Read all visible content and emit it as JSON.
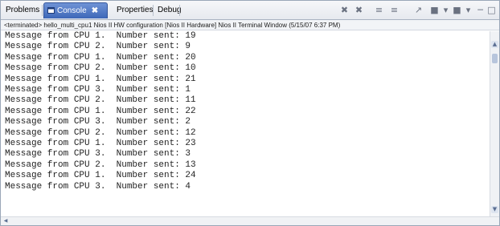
{
  "tabs": [
    {
      "label": "Problems",
      "active": false
    },
    {
      "label": "Console",
      "active": true,
      "close": "✖"
    },
    {
      "label": "Properties",
      "active": false
    },
    {
      "label": "Debug",
      "active": false
    }
  ],
  "toolbar": {
    "icons": [
      "terminate-icon",
      "remove-launches-icon",
      "clear-console-icon",
      "scroll-lock-icon",
      "pin-console-icon",
      "display-console-icon",
      "open-console-icon",
      "minimize-icon",
      "maximize-icon"
    ],
    "glyphs": [
      "✖",
      "✖",
      "≡",
      "≡",
      "↗",
      "■",
      "▾",
      "─",
      "□"
    ]
  },
  "info_line": "<terminated> hello_multi_cpu1 Nios II HW configuration [Nios II Hardware] Nios II Terminal Window (5/15/07 6:37 PM)",
  "console_lines": [
    "Message from CPU 1.  Number sent: 19",
    "Message from CPU 2.  Number sent: 9",
    "Message from CPU 1.  Number sent: 20",
    "Message from CPU 2.  Number sent: 10",
    "Message from CPU 1.  Number sent: 21",
    "Message from CPU 3.  Number sent: 1",
    "Message from CPU 2.  Number sent: 11",
    "Message from CPU 1.  Number sent: 22",
    "Message from CPU 3.  Number sent: 2",
    "Message from CPU 2.  Number sent: 12",
    "Message from CPU 1.  Number sent: 23",
    "Message from CPU 3.  Number sent: 3",
    "Message from CPU 2.  Number sent: 13",
    "Message from CPU 1.  Number sent: 24",
    "Message from CPU 3.  Number sent: 4"
  ],
  "scroll": {
    "up": "▲",
    "down": "▼",
    "left": "◀",
    "right": "▶"
  },
  "colors": {
    "active_tab": "#3d67b8",
    "text": "#222222"
  }
}
